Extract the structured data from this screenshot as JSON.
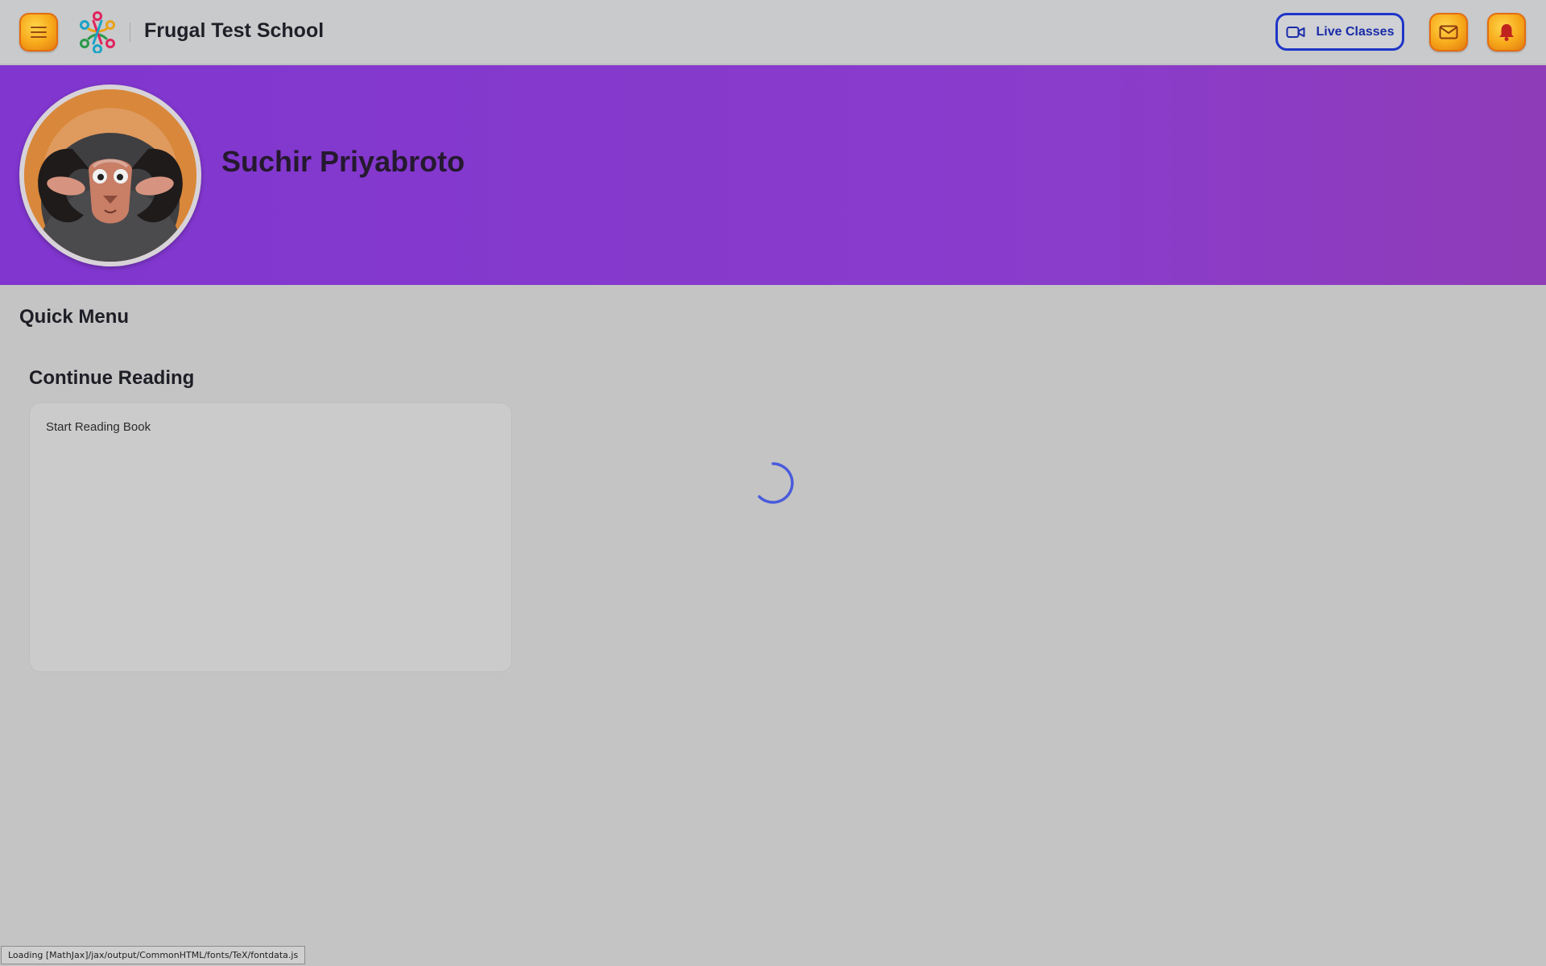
{
  "header": {
    "school_name": "Frugal Test School",
    "live_classes_label": "Live Classes",
    "icons": {
      "menu": "hamburger-icon",
      "logo": "people-circle-logo",
      "live": "video-camera-icon",
      "mail": "envelope-icon",
      "notifications": "bell-icon"
    }
  },
  "profile": {
    "name": "Suchir Priyabroto",
    "avatar": "ram-avatar"
  },
  "main": {
    "quick_menu_title": "Quick Menu",
    "continue_reading_title": "Continue Reading",
    "reading_card_text": "Start Reading Book"
  },
  "status_bar": {
    "text": "Loading [MathJax]/jax/output/CommonHTML/fonts/TeX/fontdata.js"
  },
  "colors": {
    "accent_button": "#f7a81a",
    "banner": "#8036cf",
    "live_button_border": "#1e35c8",
    "spinner": "#4a5bdc"
  }
}
